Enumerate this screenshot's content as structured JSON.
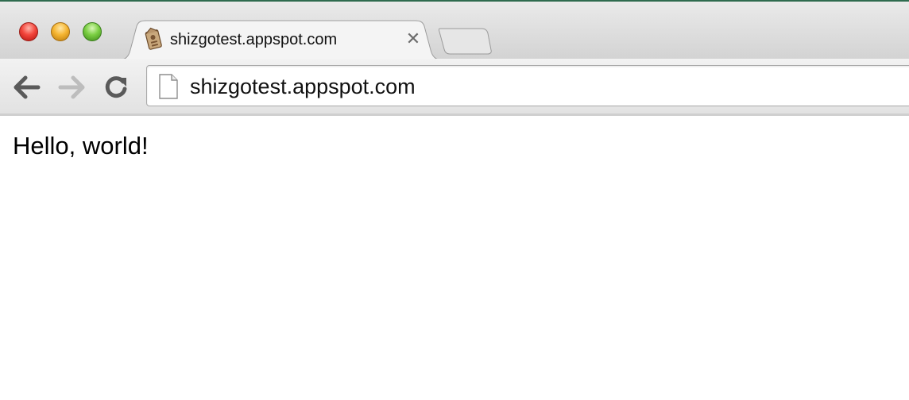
{
  "window": {
    "controls": {
      "close_color": "#f3463c",
      "minimize_color": "#f5b532",
      "zoom_color": "#7bcf43"
    }
  },
  "tabs": [
    {
      "title": "shizgotest.appspot.com",
      "favicon": "app-engine-favicon-icon",
      "close_icon": "close-icon",
      "active": true
    }
  ],
  "toolbar": {
    "back_icon": "back-arrow-icon",
    "forward_icon": "forward-arrow-icon",
    "reload_icon": "reload-icon",
    "forward_enabled": false
  },
  "omnibox": {
    "page_icon": "page-document-icon",
    "url": "shizgotest.appspot.com"
  },
  "page": {
    "body_text": "Hello, world!"
  },
  "colors": {
    "accent_line": "#2f6b4f",
    "tabstrip": "#d3d3d3",
    "toolbar": "#e2e2e2"
  }
}
